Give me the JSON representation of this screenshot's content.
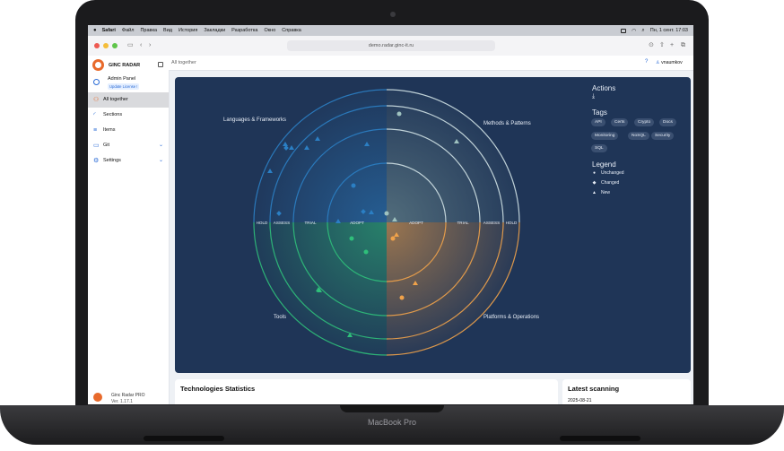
{
  "menubar": {
    "items": [
      "Safari",
      "Файл",
      "Правка",
      "Вид",
      "История",
      "Закладки",
      "Разработка",
      "Окно",
      "Справка"
    ],
    "datetime": "Пн, 1 сент. 17:03"
  },
  "browser": {
    "url": "demo.radar.ginc-it.ru"
  },
  "sidebar": {
    "app_name": "GINC RADAR",
    "admin_title": "Admin Panel",
    "admin_badge": "Update License !",
    "items": [
      {
        "label": "All together",
        "icon": "radar-icon"
      },
      {
        "label": "Sections",
        "icon": "sections-icon"
      },
      {
        "label": "Items",
        "icon": "list-icon"
      },
      {
        "label": "Git",
        "icon": "folder-icon"
      },
      {
        "label": "Settings",
        "icon": "gear-icon"
      }
    ],
    "footer_name": "Ginc Radar PRO",
    "footer_version": "Ver. 1.17.1"
  },
  "topbar": {
    "breadcrumb": "All together",
    "help": "?",
    "user": "vnaumkov"
  },
  "radar": {
    "quadrants": [
      "Languages & Frameworks",
      "Methods & Patterns",
      "Tools",
      "Platforms & Operations"
    ],
    "rings_left": [
      "HOLD",
      "ASSESS",
      "TRIAL",
      "ADOPT"
    ],
    "rings_right": [
      "ADOPT",
      "TRIAL",
      "ASSESS",
      "HOLD"
    ],
    "colors": {
      "q1": "#2b7fc4",
      "q2": "#7b9ea6",
      "q3": "#2fbf7a",
      "q4": "#f0a24a"
    }
  },
  "panel": {
    "actions_title": "Actions",
    "download_icon": "download-icon",
    "tags_title": "Tags",
    "tags": [
      "API",
      "Certs",
      "Crypto",
      "Docs",
      "Monitoring",
      "NoSQL",
      "Security",
      "SQL"
    ],
    "legend_title": "Legend",
    "legend": [
      {
        "label": "Unchanged",
        "shape": "●"
      },
      {
        "label": "Changed",
        "shape": "◆"
      },
      {
        "label": "New",
        "shape": "▲"
      }
    ]
  },
  "cards": {
    "stats_title": "Technologies Statistics",
    "latest_title": "Latest scanning",
    "latest_date": "2025-08-21"
  },
  "device": {
    "brand": "MacBook Pro"
  }
}
